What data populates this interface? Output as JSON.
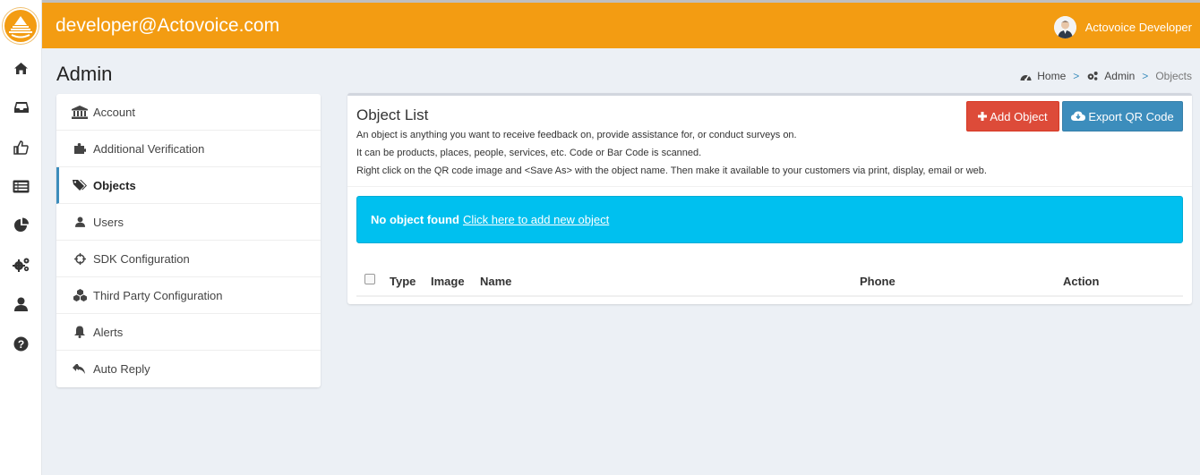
{
  "header": {
    "title": "developer@Actovoice.com",
    "user_name": "Actovoice Developer"
  },
  "rail": {
    "items": [
      {
        "icon": "home-icon"
      },
      {
        "icon": "inbox-icon"
      },
      {
        "icon": "thumbs-up-icon"
      },
      {
        "icon": "list-icon"
      },
      {
        "icon": "pie-chart-icon"
      },
      {
        "icon": "gears-icon"
      },
      {
        "icon": "user-icon"
      },
      {
        "icon": "help-icon"
      }
    ]
  },
  "page": {
    "title": "Admin",
    "breadcrumb": [
      "Home",
      "Admin",
      "Objects"
    ]
  },
  "admin_menu": {
    "items": [
      {
        "label": "Account",
        "icon": "bank-icon"
      },
      {
        "label": "Additional Verification",
        "icon": "puzzle-icon"
      },
      {
        "label": "Objects",
        "icon": "tags-icon",
        "active": true
      },
      {
        "label": "Users",
        "icon": "user-icon"
      },
      {
        "label": "SDK Configuration",
        "icon": "crosshairs-icon"
      },
      {
        "label": "Third Party Configuration",
        "icon": "cubes-icon"
      },
      {
        "label": "Alerts",
        "icon": "bell-icon"
      },
      {
        "label": "Auto Reply",
        "icon": "reply-all-icon"
      }
    ]
  },
  "object_list": {
    "title": "Object List",
    "description": [
      "An object is anything you want to receive feedback on, provide assistance for, or conduct surveys on.",
      "It can be products, places, people, services, etc. Code or Bar Code is scanned.",
      "Right click on the QR code image and <Save As> with the object name. Then make it available to your customers via print, display, email or web."
    ],
    "add_button": "Add Object",
    "export_button": "Export QR Code",
    "empty_message": "No object found",
    "empty_link": "Click here to add new object",
    "columns": [
      "Type",
      "Image",
      "Name",
      "Phone",
      "Action"
    ]
  },
  "colors": {
    "header": "#f39c12",
    "add_button": "#dd4b39",
    "export_button": "#3c8dbc",
    "callout": "#00c0ef",
    "active_border": "#3c8dbc"
  }
}
